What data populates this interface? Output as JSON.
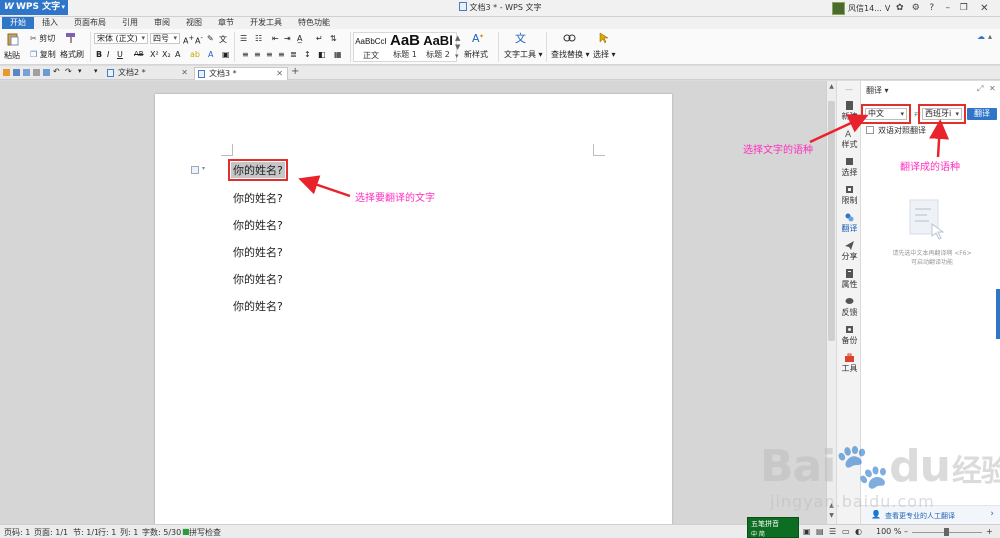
{
  "app": {
    "name": "WPS 文字",
    "window_title": "文档3 * - WPS 文字",
    "user_name": "风信14...",
    "user_badge": "V"
  },
  "tabs": [
    "开始",
    "插入",
    "页面布局",
    "引用",
    "审阅",
    "视图",
    "章节",
    "开发工具",
    "特色功能"
  ],
  "ribbon": {
    "paste": "粘贴",
    "cut": "剪切",
    "copy": "复制",
    "format_painter": "格式刷",
    "font_name": "宋体 (正文)",
    "font_size": "四号",
    "styles": [
      {
        "sample": "AaBbCcI",
        "name": "正文"
      },
      {
        "sample": "AaB",
        "name": "标题 1"
      },
      {
        "sample": "AaBl",
        "name": "标题 2"
      }
    ],
    "new_style": "新样式",
    "text_tools": "文字工具",
    "find_replace": "查找替换",
    "select": "选择"
  },
  "doc_tabs": [
    {
      "name": "文档2 *",
      "active": false
    },
    {
      "name": "文档3 *",
      "active": true
    }
  ],
  "document": {
    "lines": [
      "你的姓名?",
      "你的姓名?",
      "你的姓名?",
      "你的姓名?",
      "你的姓名?",
      "你的姓名?"
    ]
  },
  "side_tools": [
    {
      "label": "新建",
      "icon": "new-doc-icon"
    },
    {
      "label": "样式",
      "icon": "style-icon"
    },
    {
      "label": "选择",
      "icon": "select-icon"
    },
    {
      "label": "限制",
      "icon": "restrict-icon"
    },
    {
      "label": "翻译",
      "icon": "translate-icon"
    },
    {
      "label": "分享",
      "icon": "share-icon"
    },
    {
      "label": "属性",
      "icon": "properties-icon"
    },
    {
      "label": "反馈",
      "icon": "feedback-icon"
    },
    {
      "label": "备份",
      "icon": "backup-icon"
    },
    {
      "label": "工具",
      "icon": "toolbox-icon"
    }
  ],
  "translate_panel": {
    "title": "翻译",
    "source_lang": "中文",
    "target_lang": "西班牙i",
    "button": "翻译",
    "bilingual_label": "双语对照翻译",
    "hint": "请先选中文本再翻译啊 <F6>可启动翻译功能",
    "footer": "查看更专业的人工翻译"
  },
  "annotations": {
    "select_text": "选择要翻译的文字",
    "select_source": "选择文字的语种",
    "select_target": "翻译成的语种"
  },
  "status": {
    "page_num": "页码: 1",
    "pages": "页面: 1/1",
    "section": "节: 1/1",
    "row": "行: 1",
    "col": "列: 1",
    "words": "字数: 5/30",
    "spellcheck": "拼写检查",
    "zoom": "100 %",
    "ime_line1": "五笔拼音",
    "ime_line2": "中 简"
  },
  "watermark": {
    "brand": "Bai",
    "brand2": "du",
    "cn": "经验",
    "url": "jingyan.baidu.com"
  },
  "colors": {
    "accent": "#2f76c8",
    "annotation": "#ff2fbf",
    "highlight_box": "#e0302e"
  }
}
